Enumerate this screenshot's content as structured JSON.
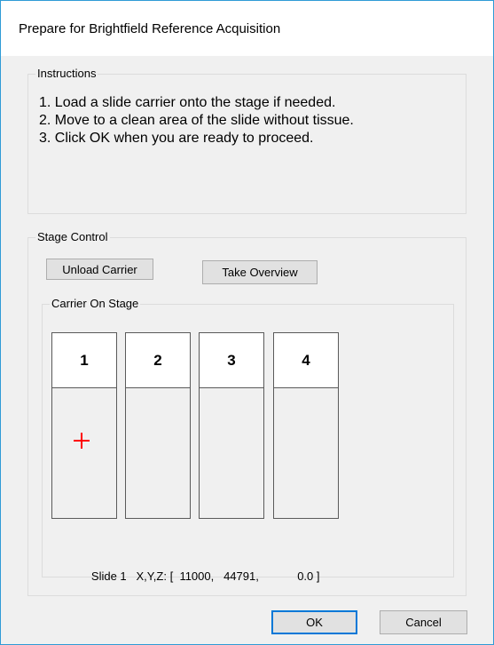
{
  "window": {
    "title": "Prepare for Brightfield Reference Acquisition"
  },
  "instructions": {
    "label": "Instructions",
    "lines": [
      "1. Load a slide carrier onto the stage if needed.",
      "2. Move to a clean area of the slide without tissue.",
      "3. Click OK when you are ready to proceed."
    ]
  },
  "stage_control": {
    "label": "Stage Control",
    "unload_label": "Unload Carrier",
    "overview_label": "Take Overview",
    "carrier": {
      "label": "Carrier On Stage",
      "slots": [
        "1",
        "2",
        "3",
        "4"
      ],
      "active_slot": "1",
      "marker_color": "#ff0000"
    },
    "position": {
      "slide_label": "Slide 1",
      "axes_label": "X,Y,Z:",
      "open_bracket": "[",
      "x": "11000,",
      "y": "44791,",
      "z": "0.0",
      "close_bracket": "]"
    }
  },
  "buttons": {
    "ok_label": "OK",
    "cancel_label": "Cancel"
  },
  "colors": {
    "accent": "#0078d7",
    "window_border": "#2f9bd6"
  }
}
